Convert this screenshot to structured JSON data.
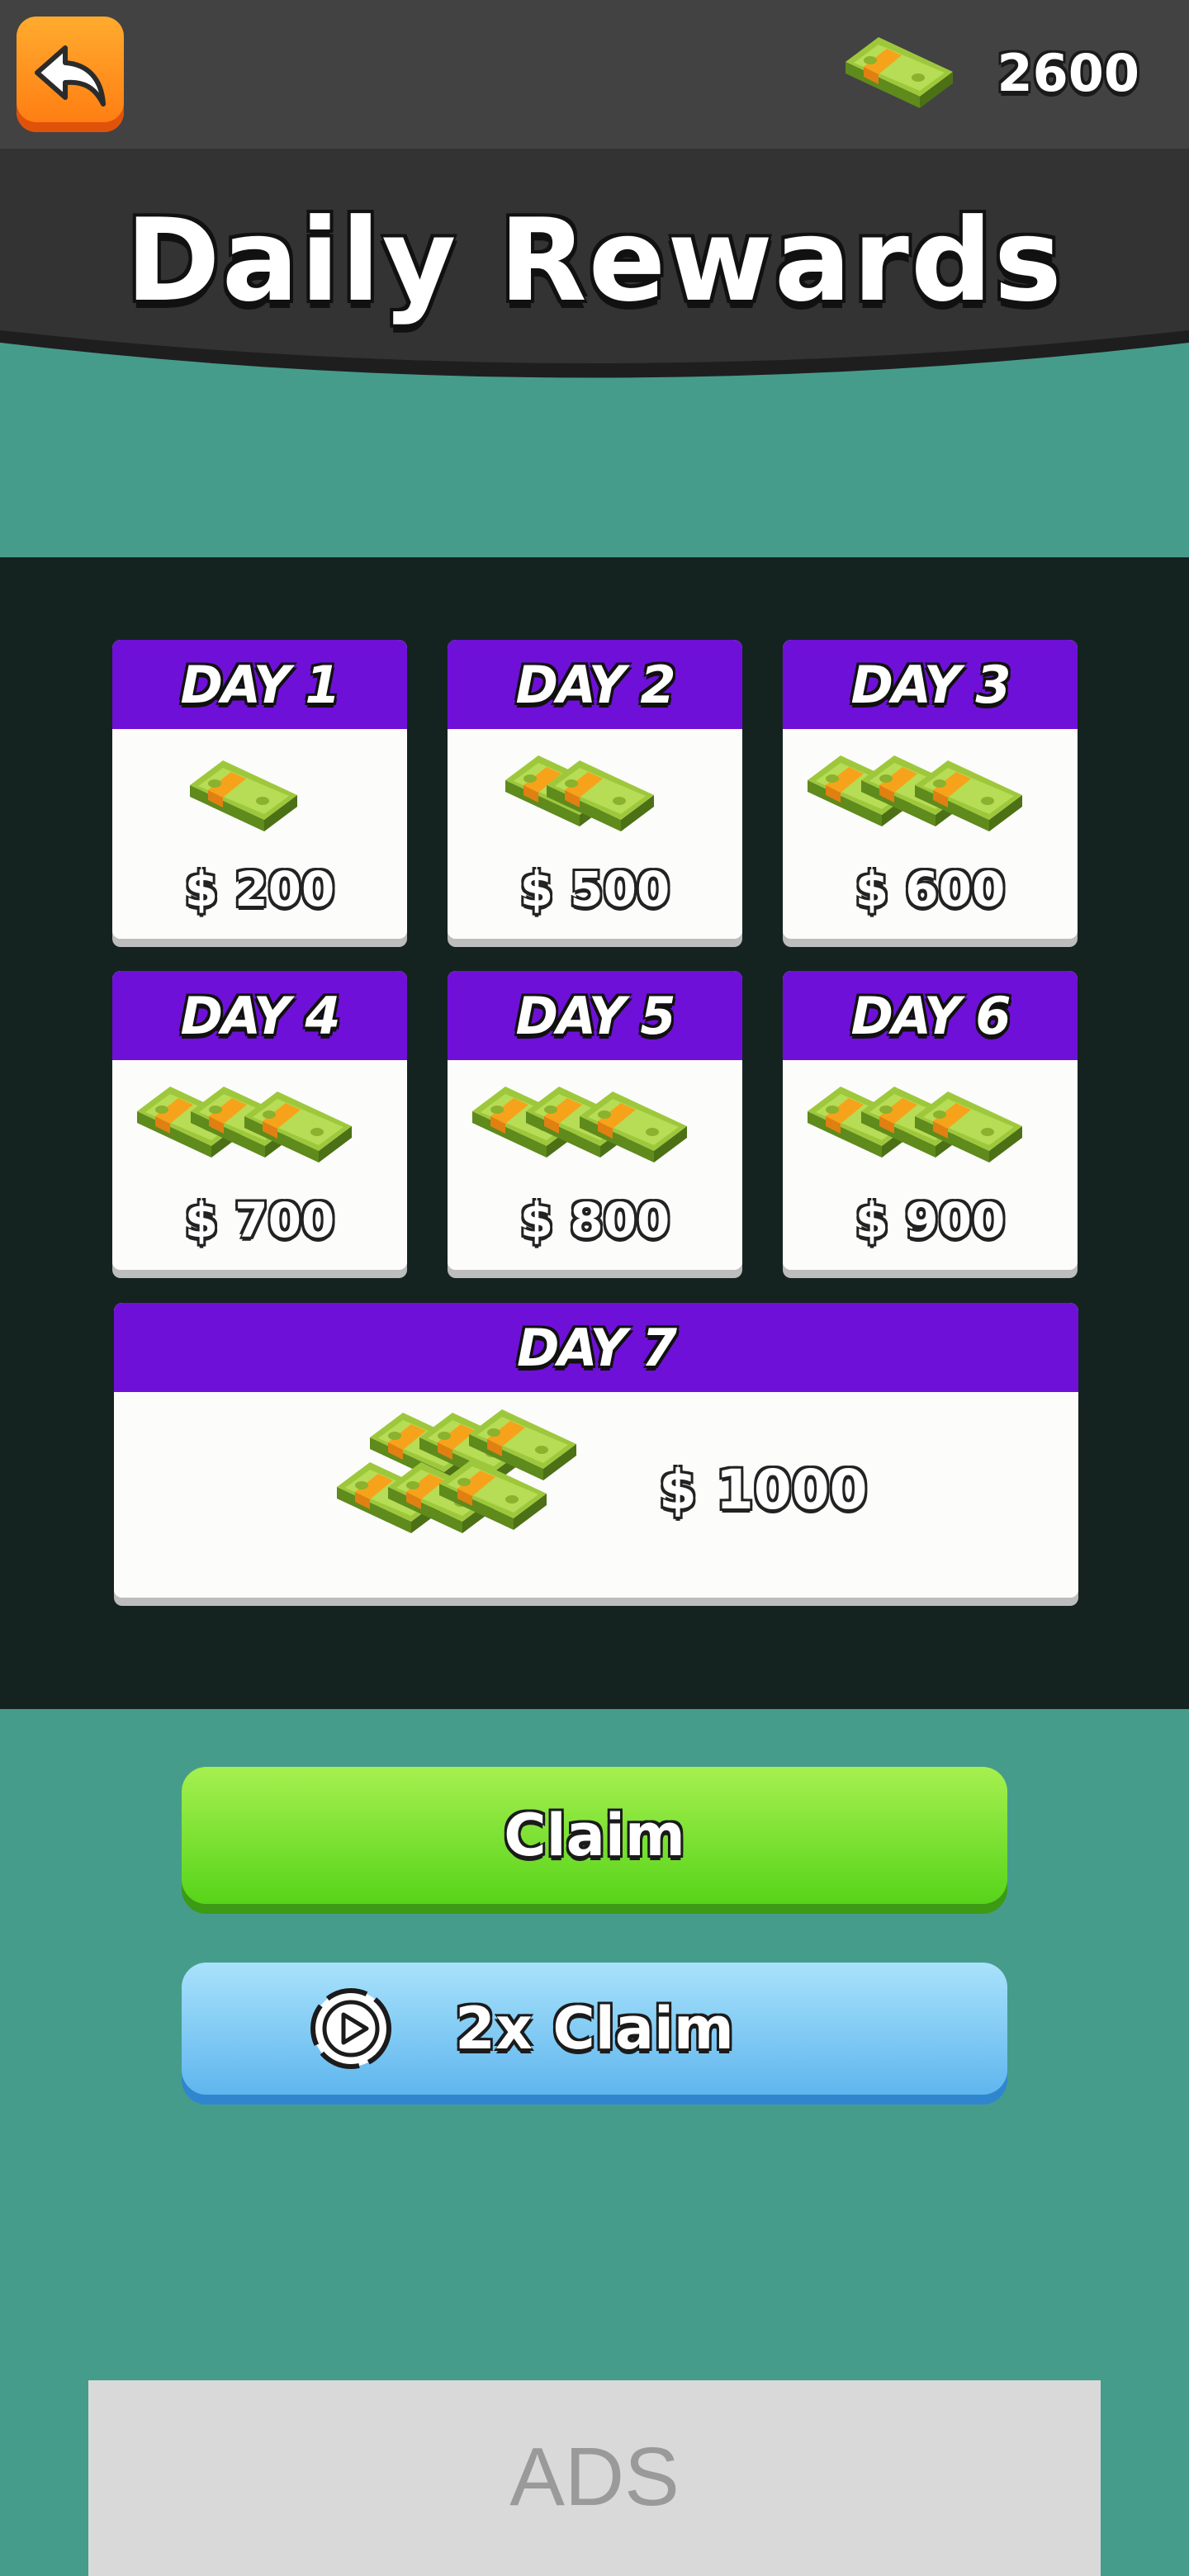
{
  "topbar": {
    "back_icon": "back-arrow-icon",
    "cash_icon": "cash-stack-icon",
    "coins": "2600"
  },
  "header": {
    "title": "Daily Rewards"
  },
  "rewards": [
    {
      "day": "DAY 1",
      "amount": "$ 200",
      "stacks": 1
    },
    {
      "day": "DAY 2",
      "amount": "$ 500",
      "stacks": 2
    },
    {
      "day": "DAY 3",
      "amount": "$ 600",
      "stacks": 3
    },
    {
      "day": "DAY 4",
      "amount": "$ 700",
      "stacks": 3
    },
    {
      "day": "DAY 5",
      "amount": "$ 800",
      "stacks": 3
    },
    {
      "day": "DAY 6",
      "amount": "$ 900",
      "stacks": 3
    },
    {
      "day": "DAY 7",
      "amount": "$ 1000",
      "stacks": 6
    }
  ],
  "buttons": {
    "claim": "Claim",
    "double_claim": "2x Claim",
    "double_claim_icon": "video-play-icon"
  },
  "ads": {
    "label": "ADS"
  },
  "colors": {
    "background": "#469c8b",
    "topbar": "#424242",
    "panel": "#152320",
    "day_header": "#6f10d8",
    "claim_green": "#57d41a",
    "double_claim_blue": "#5fb6ee",
    "back_orange": "#ff7a10"
  }
}
